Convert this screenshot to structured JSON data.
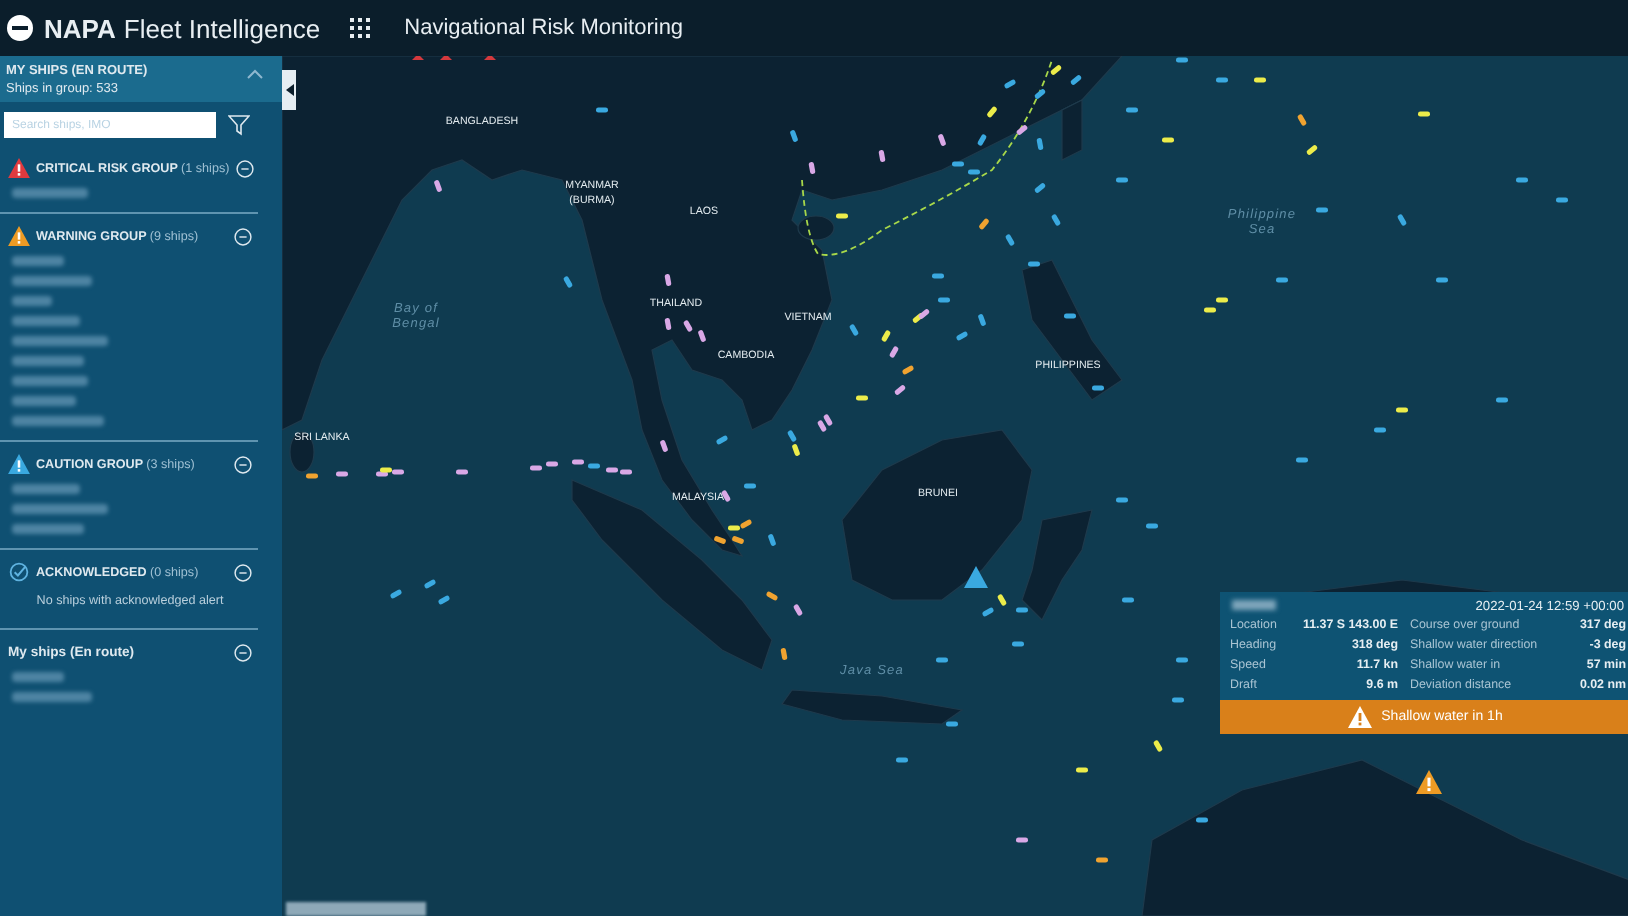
{
  "header": {
    "brand_bold": "NAPA",
    "brand_light": "Fleet Intelligence",
    "page_title": "Navigational Risk Monitoring"
  },
  "sidebar": {
    "title": "MY SHIPS (EN ROUTE)",
    "subtitle": "Ships in group: 533",
    "expanded": true,
    "search": {
      "placeholder": "Search ships, IMO"
    },
    "groups": [
      {
        "kind": "critical",
        "title": "CRITICAL RISK GROUP",
        "count": "(1 ships)",
        "expanded": true,
        "ships": [
          {
            "kind": "redacted"
          }
        ]
      },
      {
        "kind": "warning",
        "title": "WARNING GROUP",
        "count": "(9 ships)",
        "expanded": true,
        "ships": [
          {
            "kind": "redacted"
          },
          {
            "kind": "redacted"
          },
          {
            "kind": "redacted"
          },
          {
            "kind": "redacted"
          },
          {
            "kind": "redacted"
          },
          {
            "kind": "redacted"
          },
          {
            "kind": "redacted"
          },
          {
            "kind": "redacted"
          },
          {
            "kind": "redacted"
          }
        ]
      },
      {
        "kind": "caution",
        "title": "CAUTION GROUP",
        "count": "(3 ships)",
        "expanded": true,
        "ships": [
          {
            "kind": "redacted"
          },
          {
            "kind": "redacted"
          },
          {
            "kind": "redacted"
          }
        ]
      },
      {
        "kind": "acknowledged",
        "title": "ACKNOWLEDGED",
        "count": "(0 ships)",
        "expanded": true,
        "empty_text": "No ships with acknowledged alert"
      },
      {
        "kind": "plain",
        "title": "My ships (En route)",
        "expanded": true,
        "ships": [
          {
            "kind": "redacted"
          },
          {
            "kind": "redacted"
          }
        ]
      }
    ]
  },
  "map": {
    "labels": [
      {
        "kind": "country",
        "lines": [
          "BANGLADESH"
        ]
      },
      {
        "kind": "country",
        "lines": [
          "MYANMAR",
          "(BURMA)"
        ]
      },
      {
        "kind": "country",
        "lines": [
          "LAOS"
        ]
      },
      {
        "kind": "country",
        "lines": [
          "THAILAND"
        ]
      },
      {
        "kind": "country",
        "lines": [
          "VIETNAM"
        ]
      },
      {
        "kind": "country",
        "lines": [
          "CAMBODIA"
        ]
      },
      {
        "kind": "country",
        "lines": [
          "PHILIPPINES"
        ]
      },
      {
        "kind": "sea",
        "lines": [
          "Philippine",
          "Sea"
        ]
      },
      {
        "kind": "sea",
        "lines": [
          "Bay of",
          "Bengal"
        ]
      },
      {
        "kind": "country",
        "lines": [
          "SRI LANKA"
        ]
      },
      {
        "kind": "country",
        "lines": [
          "MALAYSIA"
        ]
      },
      {
        "kind": "country",
        "lines": [
          "BRUNEI"
        ]
      },
      {
        "kind": "sea",
        "lines": [
          "Java Sea"
        ]
      }
    ]
  },
  "popup": {
    "timestamp": "2022-01-24 12:59 +00:00",
    "rows": [
      {
        "label": "Location",
        "value": "11.37 S 143.00 E",
        "label_2": "Course over ground",
        "value_2": "317 deg"
      },
      {
        "label": "Heading",
        "value": "318 deg",
        "label_2": "Shallow water direction",
        "value_2": "-3 deg"
      },
      {
        "label": "Speed",
        "value": "11.7 kn",
        "label_2": "Shallow water in",
        "value_2": "57 min"
      },
      {
        "label": "Draft",
        "value": "9.6 m",
        "label_2": "Deviation distance",
        "value_2": "0.02 nm"
      }
    ],
    "alert": "Shallow water in 1h"
  }
}
